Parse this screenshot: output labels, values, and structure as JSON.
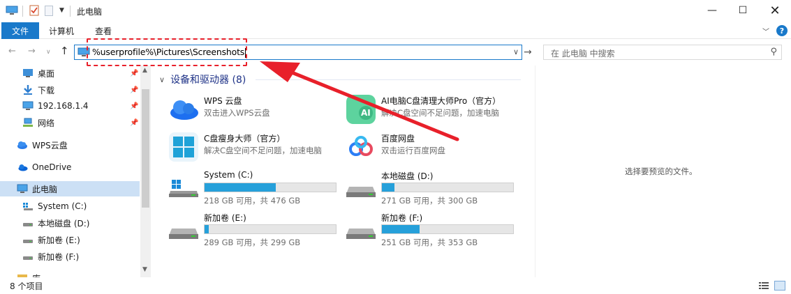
{
  "window": {
    "title": "此电脑",
    "minimize": "—",
    "maximize": "☐",
    "close": "✕"
  },
  "ribbon": {
    "tabs": [
      "文件",
      "计算机",
      "查看"
    ]
  },
  "address": {
    "path": "%userprofile%\\Pictures\\Screenshots"
  },
  "search": {
    "placeholder": "在 此电脑 中搜索"
  },
  "sidebar": {
    "items": [
      {
        "label": "桌面",
        "icon": "desktop-icon",
        "pinned": true
      },
      {
        "label": "下载",
        "icon": "download-icon",
        "pinned": true
      },
      {
        "label": "192.168.1.4",
        "icon": "monitor-icon",
        "pinned": true
      },
      {
        "label": "网络",
        "icon": "network-icon",
        "pinned": true
      },
      {
        "label": "WPS云盘",
        "icon": "cloud-icon",
        "pinned": false
      },
      {
        "label": "OneDrive",
        "icon": "onedrive-icon",
        "pinned": false
      },
      {
        "label": "此电脑",
        "icon": "pc-icon",
        "pinned": false,
        "selected": true
      },
      {
        "label": "System (C:)",
        "icon": "system-drive-icon",
        "pinned": false
      },
      {
        "label": "本地磁盘 (D:)",
        "icon": "drive-icon",
        "pinned": false
      },
      {
        "label": "新加卷 (E:)",
        "icon": "drive-icon",
        "pinned": false
      },
      {
        "label": "新加卷 (F:)",
        "icon": "drive-icon",
        "pinned": false
      },
      {
        "label": "库",
        "icon": "library-icon",
        "pinned": false
      }
    ]
  },
  "main": {
    "group_title": "设备和驱动器 (8)",
    "apps": [
      {
        "name": "WPS 云盘",
        "desc": "双击进入WPS云盘",
        "icon": "wps-cloud-icon"
      },
      {
        "name": "AI电脑C盘清理大师Pro（官方）",
        "desc": "解决C盘空间不足问题，加速电脑",
        "icon": "ai-cleaner-icon"
      },
      {
        "name": "C盘瘦身大师（官方）",
        "desc": "解决C盘空间不足问题，加速电脑",
        "icon": "c-slim-icon"
      },
      {
        "name": "百度网盘",
        "desc": "双击运行百度网盘",
        "icon": "baidu-netdisk-icon"
      }
    ],
    "drives": [
      {
        "name": "System (C:)",
        "info": "218 GB 可用，共 476 GB",
        "used_fraction": 0.542,
        "icon": "windows-drive-icon"
      },
      {
        "name": "本地磁盘 (D:)",
        "info": "271 GB 可用，共 300 GB",
        "used_fraction": 0.097,
        "icon": "hdd-icon"
      },
      {
        "name": "新加卷 (E:)",
        "info": "289 GB 可用，共 299 GB",
        "used_fraction": 0.033,
        "icon": "hdd-icon"
      },
      {
        "name": "新加卷 (F:)",
        "info": "251 GB 可用，共 353 GB",
        "used_fraction": 0.289,
        "icon": "hdd-icon"
      }
    ]
  },
  "preview": {
    "text": "选择要预览的文件。"
  },
  "status": {
    "items_count": "8 个项目"
  },
  "colors": {
    "accent": "#1979ca",
    "progress": "#26a0da",
    "annotation_red": "#e8202a",
    "selected_bg": "#cce0f5"
  }
}
